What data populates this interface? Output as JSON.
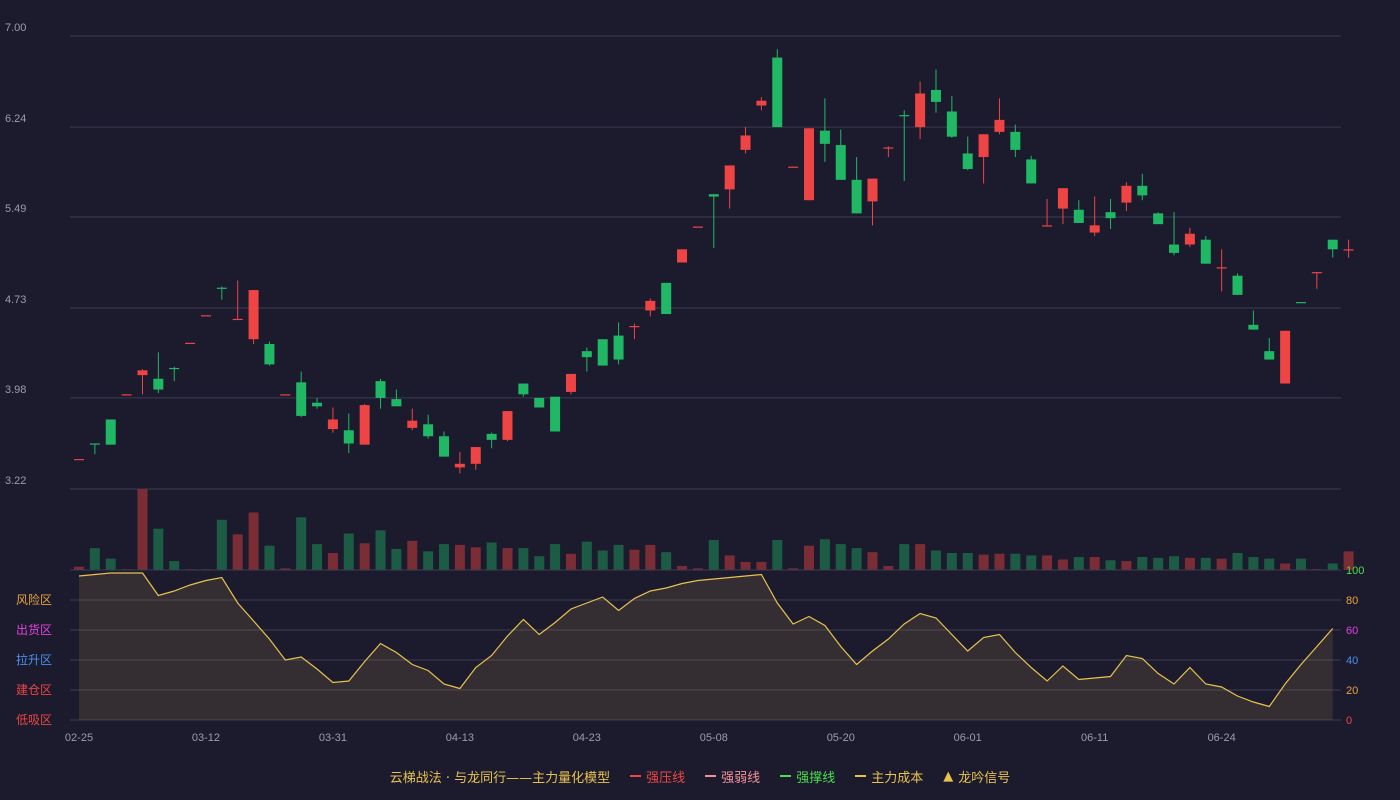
{
  "chart_data": {
    "type": "candlestick",
    "price_axis": {
      "ticks": [
        "7.00",
        "6.24",
        "5.49",
        "4.73",
        "3.98",
        "3.22"
      ]
    },
    "x_ticks": [
      {
        "label": "02-25",
        "index": 0
      },
      {
        "label": "03-12",
        "index": 8
      },
      {
        "label": "03-31",
        "index": 16
      },
      {
        "label": "04-13",
        "index": 24
      },
      {
        "label": "04-23",
        "index": 32
      },
      {
        "label": "05-08",
        "index": 40
      },
      {
        "label": "05-20",
        "index": 48
      },
      {
        "label": "06-01",
        "index": 56
      },
      {
        "label": "06-11",
        "index": 64
      },
      {
        "label": "06-24",
        "index": 72
      }
    ],
    "candles": [
      {
        "o": 3.47,
        "h": 3.47,
        "l": 3.47,
        "c": 3.47,
        "v": 4,
        "d": "up"
      },
      {
        "o": 3.6,
        "h": 3.6,
        "l": 3.51,
        "c": 3.6,
        "v": 27,
        "d": "down"
      },
      {
        "o": 3.59,
        "h": 3.8,
        "l": 3.59,
        "c": 3.8,
        "v": 14,
        "d": "down"
      },
      {
        "o": 4.01,
        "h": 4.01,
        "l": 4.01,
        "c": 4.01,
        "v": 1,
        "d": "up"
      },
      {
        "o": 4.21,
        "h": 4.22,
        "l": 4.01,
        "c": 4.17,
        "v": 100,
        "d": "up"
      },
      {
        "o": 4.05,
        "h": 4.36,
        "l": 4.02,
        "c": 4.14,
        "v": 51,
        "d": "down"
      },
      {
        "o": 4.23,
        "h": 4.24,
        "l": 4.12,
        "c": 4.23,
        "v": 11,
        "d": "down"
      },
      {
        "o": 4.44,
        "h": 4.44,
        "l": 4.44,
        "c": 4.44,
        "v": 1,
        "d": "up"
      },
      {
        "o": 4.67,
        "h": 4.67,
        "l": 4.67,
        "c": 4.67,
        "v": 1,
        "d": "up"
      },
      {
        "o": 4.9,
        "h": 4.91,
        "l": 4.8,
        "c": 4.9,
        "v": 62,
        "d": "down"
      },
      {
        "o": 4.64,
        "h": 4.96,
        "l": 4.64,
        "c": 4.64,
        "v": 44,
        "d": "up"
      },
      {
        "o": 4.88,
        "h": 4.88,
        "l": 4.43,
        "c": 4.47,
        "v": 71,
        "d": "up"
      },
      {
        "o": 4.43,
        "h": 4.45,
        "l": 4.25,
        "c": 4.26,
        "v": 30,
        "d": "down"
      },
      {
        "o": 4.01,
        "h": 4.01,
        "l": 4.01,
        "c": 4.01,
        "v": 2,
        "d": "up"
      },
      {
        "o": 4.11,
        "h": 4.2,
        "l": 3.82,
        "c": 3.83,
        "v": 65,
        "d": "down"
      },
      {
        "o": 3.94,
        "h": 3.98,
        "l": 3.89,
        "c": 3.91,
        "v": 32,
        "d": "down"
      },
      {
        "o": 3.8,
        "h": 3.9,
        "l": 3.69,
        "c": 3.72,
        "v": 21,
        "d": "up"
      },
      {
        "o": 3.6,
        "h": 3.85,
        "l": 3.52,
        "c": 3.71,
        "v": 45,
        "d": "down"
      },
      {
        "o": 3.59,
        "h": 3.93,
        "l": 3.59,
        "c": 3.92,
        "v": 33,
        "d": "up"
      },
      {
        "o": 3.98,
        "h": 4.14,
        "l": 3.89,
        "c": 4.12,
        "v": 49,
        "d": "down"
      },
      {
        "o": 3.97,
        "h": 4.05,
        "l": 3.91,
        "c": 3.91,
        "v": 26,
        "d": "down"
      },
      {
        "o": 3.79,
        "h": 3.89,
        "l": 3.71,
        "c": 3.73,
        "v": 36,
        "d": "up"
      },
      {
        "o": 3.76,
        "h": 3.84,
        "l": 3.64,
        "c": 3.66,
        "v": 23,
        "d": "down"
      },
      {
        "o": 3.66,
        "h": 3.7,
        "l": 3.49,
        "c": 3.49,
        "v": 32,
        "d": "down"
      },
      {
        "o": 3.4,
        "h": 3.53,
        "l": 3.35,
        "c": 3.43,
        "v": 31,
        "d": "up"
      },
      {
        "o": 3.43,
        "h": 3.57,
        "l": 3.38,
        "c": 3.57,
        "v": 28,
        "d": "up"
      },
      {
        "o": 3.63,
        "h": 3.69,
        "l": 3.56,
        "c": 3.68,
        "v": 34,
        "d": "down"
      },
      {
        "o": 3.63,
        "h": 3.87,
        "l": 3.62,
        "c": 3.87,
        "v": 27,
        "d": "up"
      },
      {
        "o": 4.01,
        "h": 4.1,
        "l": 3.99,
        "c": 4.1,
        "v": 27,
        "d": "down"
      },
      {
        "o": 3.9,
        "h": 3.98,
        "l": 3.9,
        "c": 3.98,
        "v": 17,
        "d": "down"
      },
      {
        "o": 3.7,
        "h": 3.99,
        "l": 3.7,
        "c": 3.99,
        "v": 32,
        "d": "down"
      },
      {
        "o": 4.03,
        "h": 4.18,
        "l": 4.01,
        "c": 4.18,
        "v": 20,
        "d": "up"
      },
      {
        "o": 4.37,
        "h": 4.4,
        "l": 4.2,
        "c": 4.32,
        "v": 35,
        "d": "down"
      },
      {
        "o": 4.25,
        "h": 4.47,
        "l": 4.25,
        "c": 4.47,
        "v": 24,
        "d": "down"
      },
      {
        "o": 4.5,
        "h": 4.61,
        "l": 4.26,
        "c": 4.3,
        "v": 31,
        "d": "down"
      },
      {
        "o": 4.57,
        "h": 4.6,
        "l": 4.47,
        "c": 4.58,
        "v": 25,
        "d": "up"
      },
      {
        "o": 4.71,
        "h": 4.81,
        "l": 4.66,
        "c": 4.79,
        "v": 31,
        "d": "up"
      },
      {
        "o": 4.68,
        "h": 4.94,
        "l": 4.68,
        "c": 4.94,
        "v": 22,
        "d": "down"
      },
      {
        "o": 5.11,
        "h": 5.22,
        "l": 5.11,
        "c": 5.22,
        "v": 5,
        "d": "up"
      },
      {
        "o": 5.41,
        "h": 5.41,
        "l": 5.41,
        "c": 5.41,
        "v": 2,
        "d": "up"
      },
      {
        "o": 5.68,
        "h": 5.68,
        "l": 5.23,
        "c": 5.66,
        "v": 37,
        "d": "down"
      },
      {
        "o": 5.72,
        "h": 5.92,
        "l": 5.56,
        "c": 5.92,
        "v": 18,
        "d": "up"
      },
      {
        "o": 6.17,
        "h": 6.24,
        "l": 6.02,
        "c": 6.05,
        "v": 10,
        "d": "up"
      },
      {
        "o": 6.46,
        "h": 6.49,
        "l": 6.38,
        "c": 6.42,
        "v": 10,
        "d": "up"
      },
      {
        "o": 6.82,
        "h": 6.89,
        "l": 6.24,
        "c": 6.24,
        "v": 37,
        "d": "down"
      },
      {
        "o": 5.91,
        "h": 5.91,
        "l": 5.91,
        "c": 5.91,
        "v": 2,
        "d": "up"
      },
      {
        "o": 6.23,
        "h": 6.23,
        "l": 5.63,
        "c": 5.63,
        "v": 30,
        "d": "up"
      },
      {
        "o": 6.21,
        "h": 6.48,
        "l": 5.95,
        "c": 6.1,
        "v": 38,
        "d": "down"
      },
      {
        "o": 6.09,
        "h": 6.22,
        "l": 5.8,
        "c": 5.8,
        "v": 32,
        "d": "down"
      },
      {
        "o": 5.8,
        "h": 5.99,
        "l": 5.52,
        "c": 5.52,
        "v": 27,
        "d": "down"
      },
      {
        "o": 5.81,
        "h": 5.81,
        "l": 5.42,
        "c": 5.62,
        "v": 22,
        "d": "up"
      },
      {
        "o": 6.07,
        "h": 6.08,
        "l": 5.99,
        "c": 6.06,
        "v": 5,
        "d": "up"
      },
      {
        "o": 6.34,
        "h": 6.38,
        "l": 5.79,
        "c": 6.34,
        "v": 32,
        "d": "down"
      },
      {
        "o": 6.52,
        "h": 6.62,
        "l": 6.14,
        "c": 6.24,
        "v": 32,
        "d": "up"
      },
      {
        "o": 6.55,
        "h": 6.72,
        "l": 6.36,
        "c": 6.45,
        "v": 24,
        "d": "down"
      },
      {
        "o": 6.37,
        "h": 6.5,
        "l": 6.15,
        "c": 6.16,
        "v": 21,
        "d": "down"
      },
      {
        "o": 6.02,
        "h": 6.16,
        "l": 5.88,
        "c": 5.89,
        "v": 21,
        "d": "down"
      },
      {
        "o": 6.18,
        "h": 6.18,
        "l": 5.77,
        "c": 5.99,
        "v": 19,
        "d": "up"
      },
      {
        "o": 6.3,
        "h": 6.48,
        "l": 6.18,
        "c": 6.2,
        "v": 20,
        "d": "up"
      },
      {
        "o": 6.2,
        "h": 6.26,
        "l": 5.99,
        "c": 6.05,
        "v": 20,
        "d": "down"
      },
      {
        "o": 5.97,
        "h": 6.0,
        "l": 5.77,
        "c": 5.77,
        "v": 18,
        "d": "down"
      },
      {
        "o": 5.42,
        "h": 5.64,
        "l": 5.42,
        "c": 5.42,
        "v": 18,
        "d": "up"
      },
      {
        "o": 5.73,
        "h": 5.73,
        "l": 5.43,
        "c": 5.56,
        "v": 13,
        "d": "up"
      },
      {
        "o": 5.55,
        "h": 5.63,
        "l": 5.44,
        "c": 5.44,
        "v": 16,
        "d": "down"
      },
      {
        "o": 5.42,
        "h": 5.66,
        "l": 5.33,
        "c": 5.36,
        "v": 16,
        "d": "up"
      },
      {
        "o": 5.53,
        "h": 5.64,
        "l": 5.39,
        "c": 5.48,
        "v": 12,
        "d": "down"
      },
      {
        "o": 5.75,
        "h": 5.78,
        "l": 5.54,
        "c": 5.61,
        "v": 11,
        "d": "up"
      },
      {
        "o": 5.75,
        "h": 5.85,
        "l": 5.63,
        "c": 5.67,
        "v": 16,
        "d": "down"
      },
      {
        "o": 5.52,
        "h": 5.53,
        "l": 5.43,
        "c": 5.43,
        "v": 15,
        "d": "down"
      },
      {
        "o": 5.26,
        "h": 5.53,
        "l": 5.17,
        "c": 5.19,
        "v": 17,
        "d": "down"
      },
      {
        "o": 5.35,
        "h": 5.4,
        "l": 5.24,
        "c": 5.26,
        "v": 15,
        "d": "up"
      },
      {
        "o": 5.3,
        "h": 5.33,
        "l": 5.1,
        "c": 5.1,
        "v": 15,
        "d": "down"
      },
      {
        "o": 5.07,
        "h": 5.22,
        "l": 4.87,
        "c": 5.07,
        "v": 14,
        "d": "up"
      },
      {
        "o": 5.0,
        "h": 5.02,
        "l": 4.84,
        "c": 4.84,
        "v": 21,
        "d": "down"
      },
      {
        "o": 4.59,
        "h": 4.71,
        "l": 4.55,
        "c": 4.55,
        "v": 16,
        "d": "down"
      },
      {
        "o": 4.37,
        "h": 4.48,
        "l": 4.3,
        "c": 4.3,
        "v": 14,
        "d": "down"
      },
      {
        "o": 4.54,
        "h": 4.54,
        "l": 4.1,
        "c": 4.1,
        "v": 8,
        "d": "up"
      },
      {
        "o": 4.78,
        "h": 4.78,
        "l": 4.78,
        "c": 4.78,
        "v": 14,
        "d": "down"
      },
      {
        "o": 5.03,
        "h": 5.03,
        "l": 4.89,
        "c": 5.03,
        "v": 1,
        "d": "up"
      },
      {
        "o": 5.3,
        "h": 5.3,
        "l": 5.15,
        "c": 5.22,
        "v": 8,
        "d": "down"
      },
      {
        "o": 5.22,
        "h": 5.3,
        "l": 5.15,
        "c": 5.22,
        "v": 23,
        "d": "up"
      }
    ],
    "oscillator": {
      "ylim": [
        0,
        100
      ],
      "ticks": [
        "100",
        "80",
        "60",
        "40",
        "20",
        "0"
      ],
      "tick_colors": [
        "#4ade4a",
        "#e9a23b",
        "#e042e0",
        "#4a8ff0",
        "#e9a23b",
        "#ef4444"
      ],
      "zones": [
        {
          "label": "风险区",
          "color": "#e9a23b"
        },
        {
          "label": "出货区",
          "color": "#e042e0"
        },
        {
          "label": "拉升区",
          "color": "#4a8ff0"
        },
        {
          "label": "建仓区",
          "color": "#ef4444"
        },
        {
          "label": "低吸区",
          "color": "#ef4444"
        }
      ],
      "values": [
        96,
        97,
        98,
        98,
        98,
        83,
        86,
        90,
        93,
        95,
        78,
        66,
        54,
        40,
        42,
        34,
        25,
        26,
        39,
        51,
        45,
        37,
        33,
        24,
        21,
        35,
        43,
        56,
        67,
        57,
        65,
        74,
        78,
        82,
        73,
        81,
        86,
        88,
        91,
        93,
        94,
        95,
        96,
        97,
        78,
        64,
        69,
        63,
        49,
        37,
        46,
        54,
        64,
        71,
        68,
        57,
        46,
        55,
        57,
        45,
        35,
        26,
        36,
        27,
        28,
        29,
        43,
        41,
        31,
        24,
        35,
        24,
        22,
        16,
        12,
        9,
        24,
        37,
        49,
        61
      ]
    },
    "colors": {
      "up": "#ef4444",
      "down": "#20b865",
      "vol_up": "#7a2d35",
      "vol_down": "#1d5c44",
      "line": "#e7c24e",
      "grid": "#3c3b52",
      "axis_text": "#9c9cae"
    },
    "legend": [
      {
        "label": "云梯战法 · 与龙同行——主力量化模型",
        "color": "#e7c24e",
        "marker": "none"
      },
      {
        "label": "强压线",
        "color": "#ef4444",
        "marker": "line"
      },
      {
        "label": "强弱线",
        "color": "#f4909a",
        "marker": "dashed"
      },
      {
        "label": "强撑线",
        "color": "#4ade4a",
        "marker": "line"
      },
      {
        "label": "主力成本",
        "color": "#e7c24e",
        "marker": "dashed"
      },
      {
        "label": "龙吟信号",
        "color": "#e7c24e",
        "marker": "triangle"
      }
    ]
  }
}
